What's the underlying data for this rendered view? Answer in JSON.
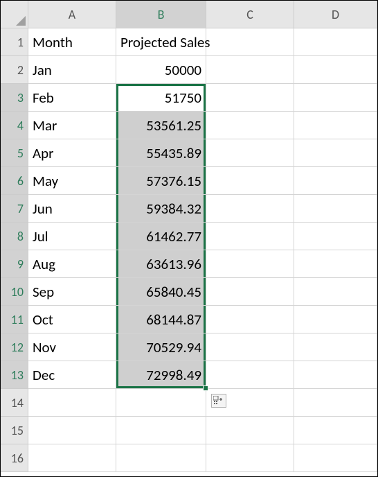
{
  "columns": [
    "A",
    "B",
    "C",
    "D"
  ],
  "rowCount": 16,
  "activeCol": "B",
  "activeRows": [
    3,
    4,
    5,
    6,
    7,
    8,
    9,
    10,
    11,
    12,
    13
  ],
  "cells": {
    "A1": "Month",
    "B1": "Projected Sales",
    "A2": "Jan",
    "B2": "50000",
    "A3": "Feb",
    "B3": "51750",
    "A4": "Mar",
    "B4": "53561.25",
    "A5": "Apr",
    "B5": "55435.89",
    "A6": "May",
    "B6": "57376.15",
    "A7": "Jun",
    "B7": "59384.32",
    "A8": "Jul",
    "B8": "61462.77",
    "A9": "Aug",
    "B9": "63613.96",
    "A10": "Sep",
    "B10": "65840.45",
    "A11": "Oct",
    "B11": "68144.87",
    "A12": "Nov",
    "B12": "70529.94",
    "A13": "Dec",
    "B13": "72998.49"
  },
  "selection": {
    "col": "B",
    "startRow": 3,
    "endRow": 13,
    "shadedStart": 4
  },
  "autofillOptionsVisible": true
}
